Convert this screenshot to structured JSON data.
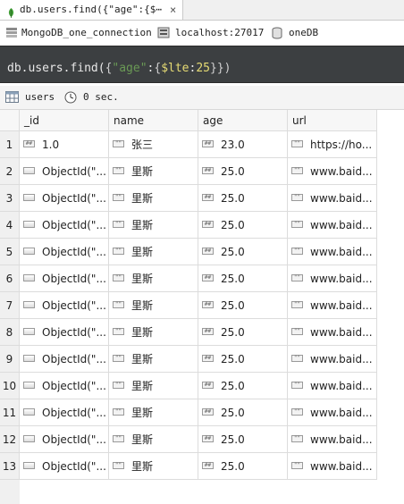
{
  "tab": {
    "title": "db.users.find({\"age\":{$⋯",
    "close": "×",
    "leaf_icon": "leaf-icon"
  },
  "connection": {
    "name": "MongoDB_one_connection",
    "host": "localhost:27017",
    "database": "oneDB"
  },
  "query": {
    "prefix": "db.users.find(",
    "open": "{",
    "key": "\"age\"",
    "colon": ":",
    "inner_open": "{",
    "op": "$lte",
    "colon2": ":",
    "value": "25",
    "close": "}})"
  },
  "results": {
    "collection": "users",
    "time": "0 sec."
  },
  "columns": [
    "_id",
    "name",
    "age",
    "url"
  ],
  "rows": [
    {
      "n": "1",
      "id": "1.0",
      "id_type": "num",
      "name": "张三",
      "age": "23.0",
      "url": "https://ho..."
    },
    {
      "n": "2",
      "id": "ObjectId(\"...",
      "id_type": "obj",
      "name": "里斯",
      "age": "25.0",
      "url": "www.baid..."
    },
    {
      "n": "3",
      "id": "ObjectId(\"...",
      "id_type": "obj",
      "name": "里斯",
      "age": "25.0",
      "url": "www.baid..."
    },
    {
      "n": "4",
      "id": "ObjectId(\"...",
      "id_type": "obj",
      "name": "里斯",
      "age": "25.0",
      "url": "www.baid..."
    },
    {
      "n": "5",
      "id": "ObjectId(\"...",
      "id_type": "obj",
      "name": "里斯",
      "age": "25.0",
      "url": "www.baid..."
    },
    {
      "n": "6",
      "id": "ObjectId(\"...",
      "id_type": "obj",
      "name": "里斯",
      "age": "25.0",
      "url": "www.baid..."
    },
    {
      "n": "7",
      "id": "ObjectId(\"...",
      "id_type": "obj",
      "name": "里斯",
      "age": "25.0",
      "url": "www.baid..."
    },
    {
      "n": "8",
      "id": "ObjectId(\"...",
      "id_type": "obj",
      "name": "里斯",
      "age": "25.0",
      "url": "www.baid..."
    },
    {
      "n": "9",
      "id": "ObjectId(\"...",
      "id_type": "obj",
      "name": "里斯",
      "age": "25.0",
      "url": "www.baid..."
    },
    {
      "n": "10",
      "id": "ObjectId(\"...",
      "id_type": "obj",
      "name": "里斯",
      "age": "25.0",
      "url": "www.baid..."
    },
    {
      "n": "11",
      "id": "ObjectId(\"...",
      "id_type": "obj",
      "name": "里斯",
      "age": "25.0",
      "url": "www.baid..."
    },
    {
      "n": "12",
      "id": "ObjectId(\"...",
      "id_type": "obj",
      "name": "里斯",
      "age": "25.0",
      "url": "www.baid..."
    },
    {
      "n": "13",
      "id": "ObjectId(\"...",
      "id_type": "obj",
      "name": "里斯",
      "age": "25.0",
      "url": "www.baid..."
    }
  ],
  "badges": {
    "num": "##",
    "str": "\"\""
  },
  "colors": {
    "editor_bg": "#3c3f41",
    "query_text": "#e8e8e8",
    "string": "#6a9955",
    "operator": "#e6db74"
  }
}
